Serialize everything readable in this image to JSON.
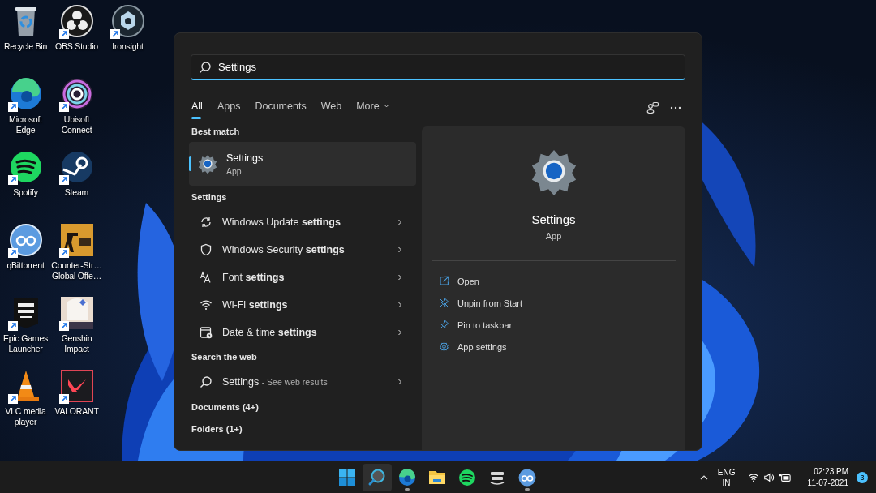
{
  "desktop": {
    "rows": [
      [
        {
          "label": "Recycle Bin",
          "shortcut": false
        },
        {
          "label": "OBS Studio",
          "shortcut": true
        },
        {
          "label": "Ironsight",
          "shortcut": true
        }
      ],
      [
        {
          "label": "Microsoft Edge",
          "shortcut": true
        },
        {
          "label": "Ubisoft Connect",
          "shortcut": true
        }
      ],
      [
        {
          "label": "Spotify",
          "shortcut": true
        },
        {
          "label": "Steam",
          "shortcut": true
        }
      ],
      [
        {
          "label": "qBittorrent",
          "shortcut": true
        },
        {
          "label": "Counter-Str… Global Offe…",
          "shortcut": true
        }
      ],
      [
        {
          "label": "Epic Games Launcher",
          "shortcut": true
        },
        {
          "label": "Genshin Impact",
          "shortcut": true
        }
      ],
      [
        {
          "label": "VLC media player",
          "shortcut": true
        },
        {
          "label": "VALORANT",
          "shortcut": true
        }
      ]
    ]
  },
  "search": {
    "value": "Settings",
    "tabs": [
      {
        "label": "All",
        "selected": true,
        "dropdown": false
      },
      {
        "label": "Apps",
        "selected": false,
        "dropdown": false
      },
      {
        "label": "Documents",
        "selected": false,
        "dropdown": false
      },
      {
        "label": "Web",
        "selected": false,
        "dropdown": false
      },
      {
        "label": "More",
        "selected": false,
        "dropdown": true
      }
    ],
    "best_match": {
      "heading": "Best match",
      "title": "Settings",
      "subtitle": "App",
      "selected": true
    },
    "settings_group": {
      "heading": "Settings",
      "items": [
        "Windows Update **settings**",
        "Windows Security **settings**",
        "Font **settings**",
        "Wi-Fi **settings**",
        "Date & time **settings**"
      ]
    },
    "web_group": {
      "heading": "Search the web",
      "items": [
        {
          "query": "Settings",
          "hint": "- See web results"
        }
      ]
    },
    "more_groups": [
      "Documents (4+)",
      "Folders (1+)"
    ],
    "preview": {
      "title": "Settings",
      "subtitle": "App",
      "actions": [
        "Open",
        "Unpin from Start",
        "Pin to taskbar",
        "App settings"
      ]
    }
  },
  "taskbar": {
    "apps": [
      {
        "selected": false,
        "running": false
      },
      {
        "selected": true,
        "running": false
      },
      {
        "selected": false,
        "running": true
      },
      {
        "selected": false,
        "running": false
      },
      {
        "selected": false,
        "running": false
      },
      {
        "selected": false,
        "running": false
      },
      {
        "selected": false,
        "running": true
      }
    ],
    "tray": {
      "language": "ENG",
      "region": "IN",
      "time": "02:23 PM",
      "date": "11-07-2021",
      "notifications": "3"
    }
  }
}
